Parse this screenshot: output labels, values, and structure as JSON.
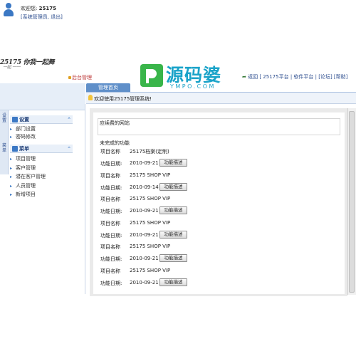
{
  "header": {
    "logo_text": "25175 你我一起舞",
    "logo_sub": "一起 一一",
    "backend_title": "后台管理",
    "brand_cn": "源码婆",
    "brand_en": "YMPO.COM",
    "links": {
      "back": "返回",
      "platform": "[ 25175平台",
      "software": "| 软件平台",
      "forum": "| [论坛]",
      "help": "[帮助]"
    }
  },
  "user": {
    "welcome_label": "欢迎您:",
    "username": "25175",
    "role_actions": "[系统管理员, 退出]"
  },
  "tabs": {
    "home": "管理首页"
  },
  "notice": "欢迎使用25175管理系统!",
  "sidebar": {
    "vtabs": [
      "设置",
      "菜单"
    ],
    "groups": [
      {
        "title": "设置",
        "items": [
          "部门设置",
          "密码修改"
        ]
      },
      {
        "title": "菜单",
        "items": [
          "项目管理",
          "客户管理",
          "潜在客户管理",
          "人员管理",
          "新增项目"
        ]
      }
    ]
  },
  "main": {
    "section1_title": "应续费的网站",
    "section2_title": "未完成的功能",
    "project_label": "项目名称",
    "date_label": "功能日期:",
    "button_label": "功能描述",
    "projects": [
      {
        "name": "25175档案(定制)",
        "date": "2010-09-21"
      },
      {
        "name": "25175 SHOP VIP",
        "date": "2010-09-14"
      },
      {
        "name": "25175 SHOP VIP",
        "date": "2010-09-21"
      },
      {
        "name": "25175 SHOP VIP",
        "date": "2010-09-21"
      },
      {
        "name": "25175 SHOP VIP",
        "date": "2010-09-21"
      },
      {
        "name": "25175 SHOP VIP",
        "date": "2010-09-21"
      }
    ]
  },
  "colors": {
    "accent": "#5f8fc9",
    "brand": "#1aa3c9",
    "brand_mark": "#39b54a",
    "link": "#2a4b8d"
  }
}
